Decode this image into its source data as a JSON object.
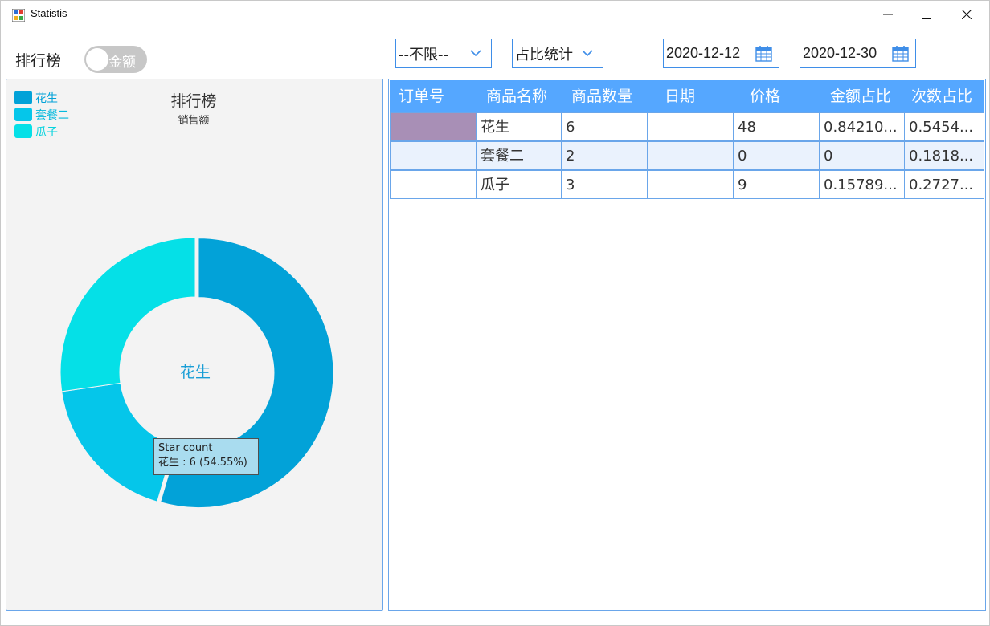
{
  "window": {
    "title": "Statistis",
    "controls": [
      "minimize-icon",
      "maximize-icon",
      "close-icon"
    ]
  },
  "toolbar": {
    "label": "排行榜",
    "toggle": {
      "text": "金额",
      "on": false
    },
    "filter_dropdown": {
      "value": "--不限--"
    },
    "stat_dropdown": {
      "value": "占比统计"
    },
    "date_from": "2020-12-12",
    "date_to": "2020-12-30"
  },
  "chart_data": {
    "type": "pie",
    "title": "排行榜",
    "subtitle": "销售额",
    "center_label": "花生",
    "categories": [
      "花生",
      "套餐二",
      "瓜子"
    ],
    "values": [
      6,
      2,
      3
    ],
    "percentages": [
      54.55,
      18.18,
      27.27
    ],
    "colors": [
      "#02a2d8",
      "#05c6ea",
      "#05e0e7"
    ],
    "legend_position": "top-left",
    "tooltip": {
      "title": "Star count",
      "text": "花生 : 6 (54.55%)"
    }
  },
  "table": {
    "columns": [
      "订单号",
      "商品名称",
      "商品数量",
      "日期",
      "价格",
      "金额占比",
      "次数占比"
    ],
    "rows": [
      [
        "",
        "花生",
        "6",
        "",
        "48",
        "0.84210...",
        "0.5454..."
      ],
      [
        "",
        "套餐二",
        "2",
        "",
        "0",
        "0",
        "0.1818..."
      ],
      [
        "",
        "瓜子",
        "3",
        "",
        "9",
        "0.15789...",
        "0.2727..."
      ]
    ],
    "selected_cell_color": "#a88fb6",
    "alt_row_color": "#eaf2fd",
    "header_color": "#55a7ff"
  }
}
